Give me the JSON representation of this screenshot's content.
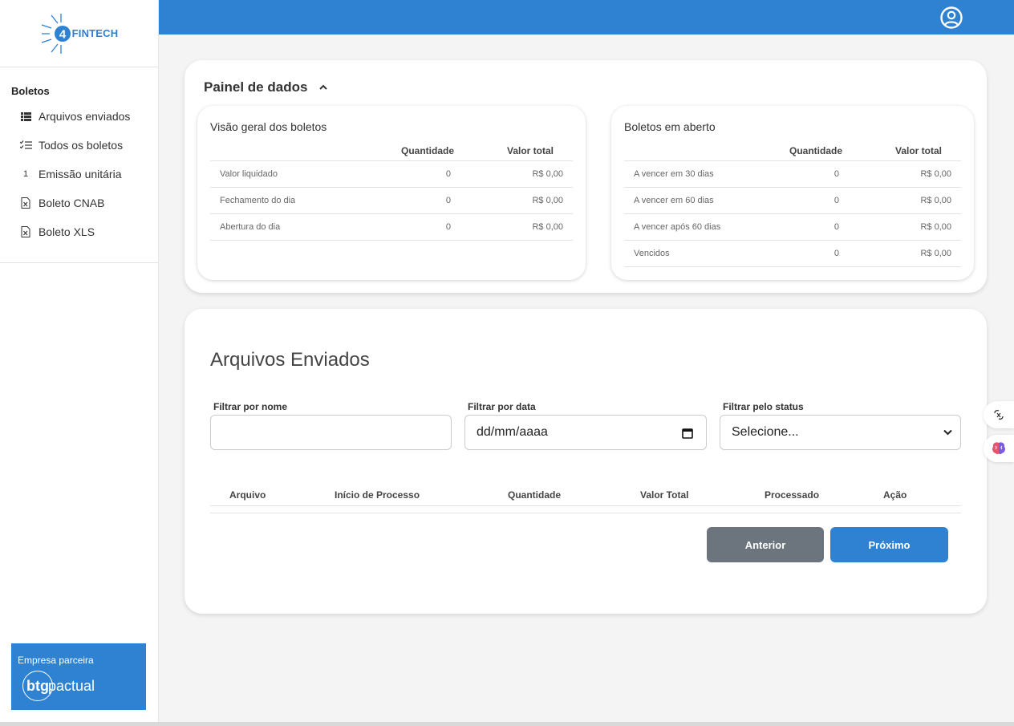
{
  "brand": {
    "name": "FINTECH",
    "digit": "4"
  },
  "sidebar": {
    "section": "Boletos",
    "items": [
      {
        "label": "Arquivos enviados",
        "icon": "list-icon"
      },
      {
        "label": "Todos os boletos",
        "icon": "checklist-icon"
      },
      {
        "label": "Emissão unitária",
        "icon": "number-one-icon"
      },
      {
        "label": "Boleto CNAB",
        "icon": "file-x-icon"
      },
      {
        "label": "Boleto XLS",
        "icon": "file-x-icon"
      }
    ],
    "partner": {
      "label": "Empresa parceira",
      "logo_bold": "btg",
      "logo_text": "pactual"
    }
  },
  "panel": {
    "title": "Painel de dados",
    "overview": {
      "title": "Visão geral dos boletos",
      "headers": [
        "Quantidade",
        "Valor total"
      ],
      "rows": [
        {
          "label": "Valor liquidado",
          "qty": "0",
          "value": "R$ 0,00"
        },
        {
          "label": "Fechamento do dia",
          "qty": "0",
          "value": "R$ 0,00"
        },
        {
          "label": "Abertura do dia",
          "qty": "0",
          "value": "R$ 0,00"
        }
      ]
    },
    "open": {
      "title": "Boletos em aberto",
      "headers": [
        "Quantidade",
        "Valor total"
      ],
      "rows": [
        {
          "label": "A vencer em 30 dias",
          "qty": "0",
          "value": "R$ 0,00"
        },
        {
          "label": "A vencer em 60 dias",
          "qty": "0",
          "value": "R$ 0,00"
        },
        {
          "label": "A vencer após 60 dias",
          "qty": "0",
          "value": "R$ 0,00"
        },
        {
          "label": "Vencidos",
          "qty": "0",
          "value": "R$ 0,00"
        }
      ]
    }
  },
  "files": {
    "title": "Arquivos Enviados",
    "filters": {
      "name_label": "Filtrar por nome",
      "name_value": "",
      "date_label": "Filtrar por data",
      "date_value": "dd/mm/aaaa",
      "status_label": "Filtrar pelo status",
      "status_value": "Selecione..."
    },
    "columns": [
      "Arquivo",
      "Início de Processo",
      "Quantidade",
      "Valor Total",
      "Processado",
      "Ação"
    ],
    "prev_label": "Anterior",
    "next_label": "Próximo"
  },
  "colors": {
    "accent": "#2f82d2",
    "secondary": "#6c757d"
  }
}
